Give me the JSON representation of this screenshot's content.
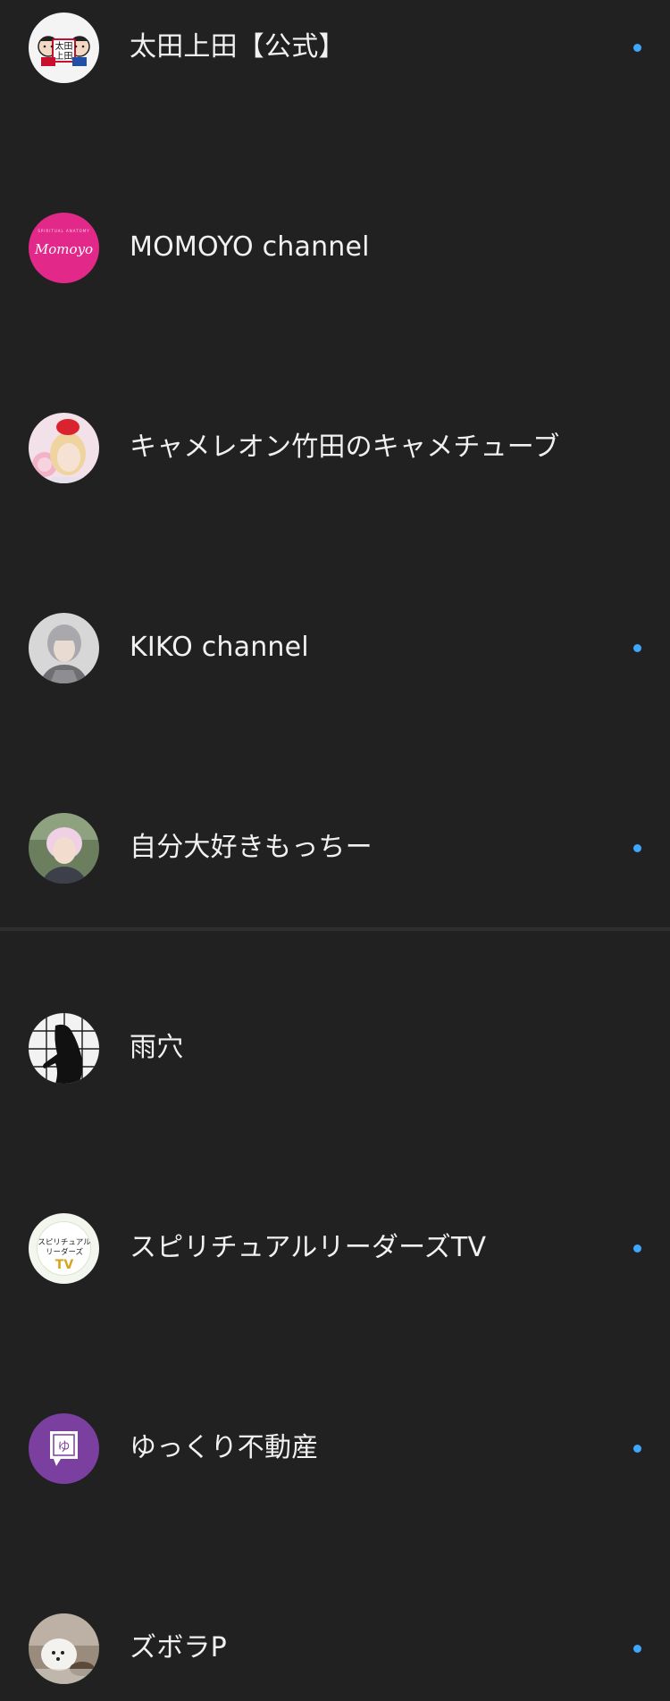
{
  "channels": [
    {
      "name": "太田上田【公式】",
      "has_new": true,
      "avatar_icon": "ohta-ueda-logo-icon",
      "avatar_text": "太田上田"
    },
    {
      "name": "MOMOYO channel",
      "has_new": false,
      "avatar_icon": "momoyo-logo-icon",
      "avatar_text": "Momoyo"
    },
    {
      "name": "キャメレオン竹田のキャメチューブ",
      "has_new": false,
      "avatar_icon": "person-photo-icon"
    },
    {
      "name": "KIKO channel",
      "has_new": true,
      "avatar_icon": "person-photo-icon"
    },
    {
      "name": "自分大好きもっちー",
      "has_new": true,
      "avatar_icon": "person-photo-icon"
    },
    {
      "name": "雨穴",
      "has_new": false,
      "avatar_icon": "silhouette-photo-icon"
    },
    {
      "name": "スピリチュアルリーダーズTV",
      "has_new": true,
      "avatar_icon": "spiritual-leaders-logo-icon",
      "avatar_text": [
        "スピリチュアル",
        "リーダーズ",
        "TV"
      ]
    },
    {
      "name": "ゆっくり不動産",
      "has_new": true,
      "avatar_icon": "yukkuri-logo-icon",
      "avatar_text": "ゆ"
    },
    {
      "name": "ズボラP",
      "has_new": true,
      "avatar_icon": "dog-photo-icon"
    }
  ],
  "colors": {
    "background": "#212121",
    "text": "#f1f1f1",
    "new_indicator": "#3ea6ff"
  }
}
